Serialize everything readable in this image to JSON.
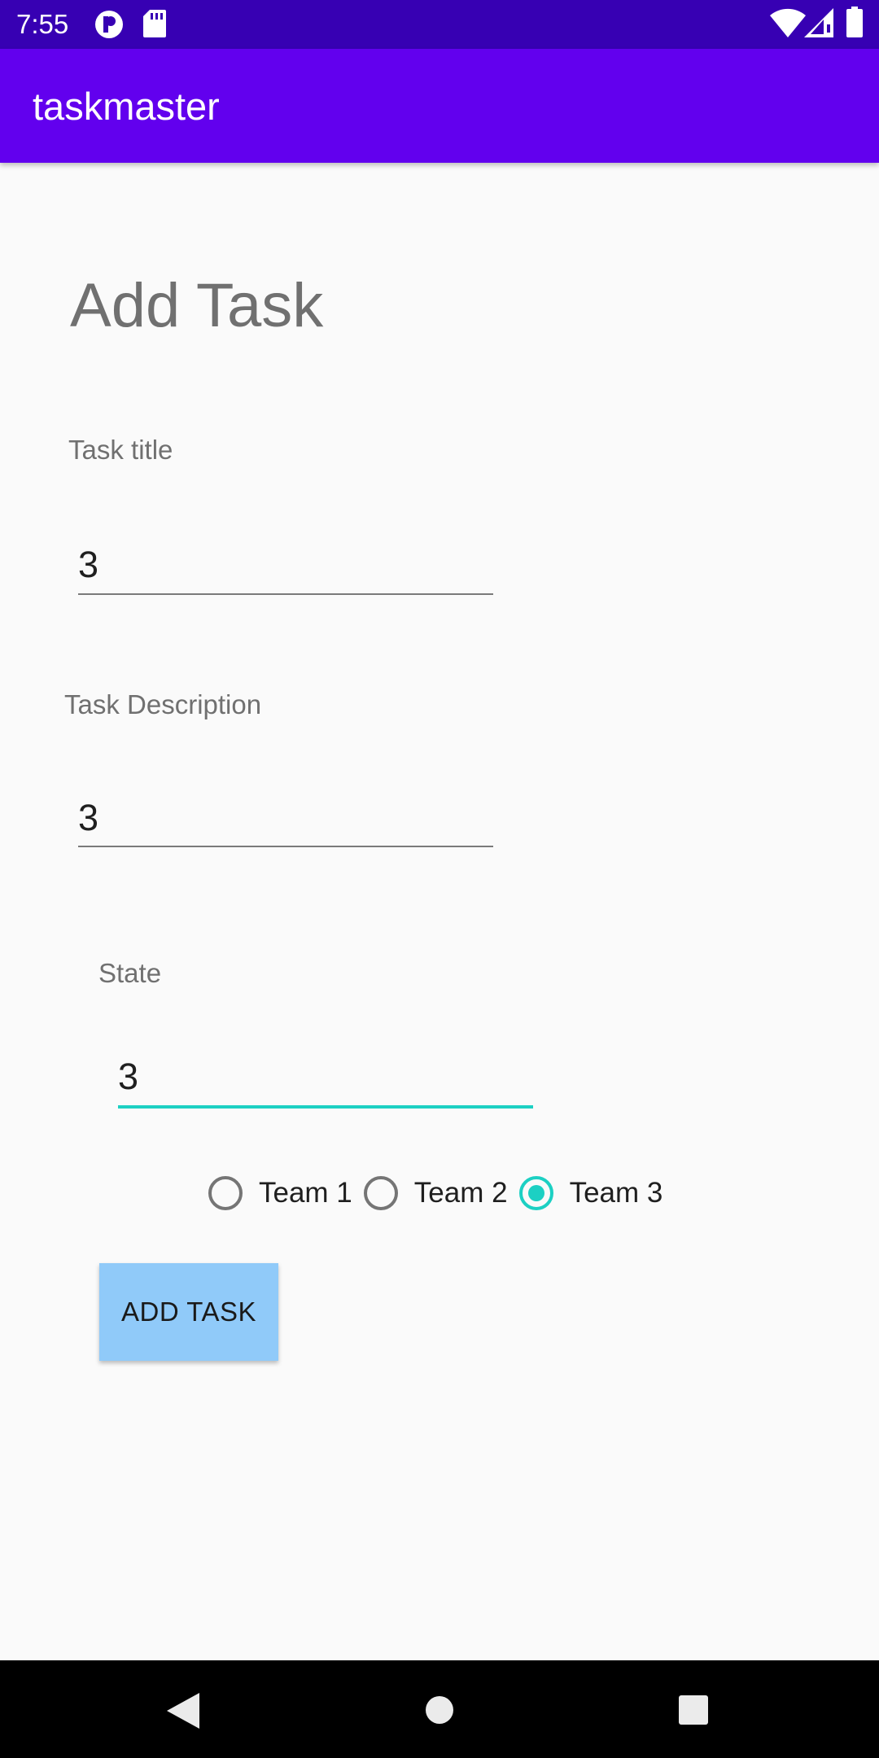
{
  "status_bar": {
    "time": "7:55",
    "icons": [
      "notification-app-icon",
      "sd-card-icon",
      "wifi-icon",
      "cell-signal-icon",
      "battery-icon"
    ]
  },
  "app_bar": {
    "title": "taskmaster",
    "color": "#6200EE",
    "status_color": "#3700B3"
  },
  "form": {
    "heading": "Add Task",
    "task_title": {
      "label": "Task title",
      "value": "3"
    },
    "task_description": {
      "label": "Task Description",
      "value": "3"
    },
    "state": {
      "label": "State",
      "value": "3",
      "focused": true
    },
    "teams": [
      {
        "label": "Team 1",
        "selected": false
      },
      {
        "label": "Team 2",
        "selected": false
      },
      {
        "label": "Team 3",
        "selected": true
      }
    ],
    "submit_label": "ADD TASK",
    "accent_color": "#1CD0C3",
    "button_color": "#90CAF9"
  },
  "nav_bar": {
    "icons": [
      "back-icon",
      "home-icon",
      "recents-icon"
    ]
  }
}
